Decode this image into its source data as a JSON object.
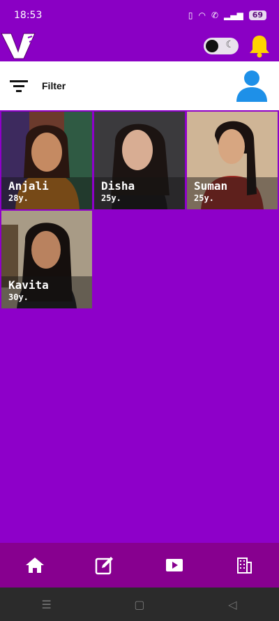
{
  "status_bar": {
    "time": "18:53",
    "battery": "69"
  },
  "header": {
    "logo_letter": "V",
    "theme_toggle_icon": "moon-icon",
    "notification_icon": "bell-icon"
  },
  "filter": {
    "label": "Filter"
  },
  "profiles": [
    {
      "name": "Anjali",
      "age": "28y."
    },
    {
      "name": "Disha",
      "age": "25y."
    },
    {
      "name": "Suman",
      "age": "25y."
    },
    {
      "name": "Kavita",
      "age": "30y."
    }
  ],
  "bottom_nav": [
    "home-icon",
    "edit-icon",
    "video-icon",
    "building-icon"
  ],
  "colors": {
    "primary": "#8e00c9",
    "nav": "#87008f",
    "accent": "#1e90e8",
    "bell": "#ffd200"
  }
}
